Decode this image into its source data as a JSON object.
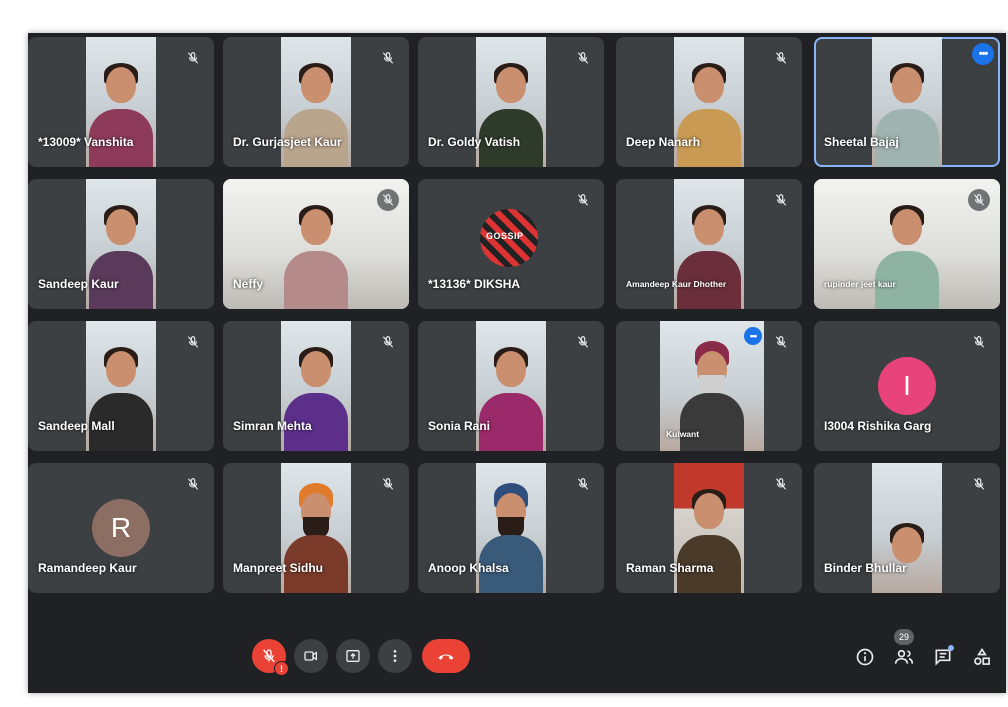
{
  "participants": [
    {
      "name": "*13009* Vanshita"
    },
    {
      "name": "Dr. Gurjasjeet Kaur"
    },
    {
      "name": "Dr. Goldy Vatish"
    },
    {
      "name": "Deep Nanarh"
    },
    {
      "name": "Sheetal Bajaj"
    },
    {
      "name": "Sandeep Kaur"
    },
    {
      "name": "Neffy"
    },
    {
      "name": "*13136* DIKSHA"
    },
    {
      "name": "Amandeep Kaur Dhother"
    },
    {
      "name": "rupinder jeet kaur"
    },
    {
      "name": "Sandeep Mall"
    },
    {
      "name": "Simran Mehta"
    },
    {
      "name": "Sonia Rani"
    },
    {
      "name": "Kulwant"
    },
    {
      "name": "I3004 Rishika Garg",
      "avatar_letter": "I",
      "avatar_color": "#e8437a"
    },
    {
      "name": "Ramandeep Kaur",
      "avatar_letter": "R",
      "avatar_color": "#8d6e63"
    },
    {
      "name": "Manpreet Sidhu"
    },
    {
      "name": "Anoop Khalsa"
    },
    {
      "name": "Raman Sharma"
    },
    {
      "name": "Binder Bhullar"
    }
  ],
  "diksha_video_text": "GOSSIP",
  "controls": {
    "mic": {
      "icon": "mic-off-icon",
      "alert": "!"
    },
    "camera": {
      "icon": "camera-icon"
    },
    "present": {
      "icon": "present-screen-icon"
    },
    "more": {
      "icon": "more-options-icon"
    },
    "end_call": {
      "icon": "end-call-icon"
    }
  },
  "right_panel": {
    "people_count": "29",
    "icons": [
      "info-icon",
      "people-icon",
      "chat-icon",
      "activities-icon"
    ]
  },
  "colors": {
    "background": "#202124",
    "tile": "#3c4043",
    "end_call": "#ea4335",
    "active_border": "#8ab4f8"
  }
}
